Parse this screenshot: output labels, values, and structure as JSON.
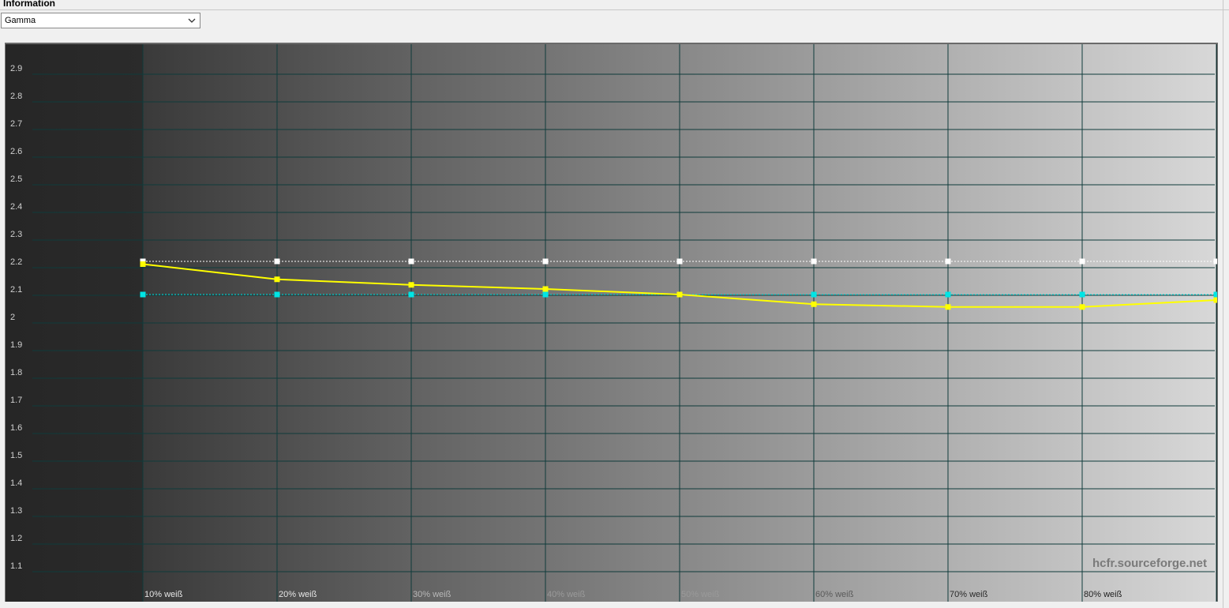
{
  "panel": {
    "title": "Information",
    "select_value": "Gamma"
  },
  "chart_data": {
    "type": "line",
    "title": "",
    "xlabel": "",
    "ylabel": "",
    "categories": [
      "",
      "10% weiß",
      "20% weiß",
      "30% weiß",
      "40% weiß",
      "50% weiß",
      "60% weiß",
      "70% weiß",
      "80% weiß",
      ""
    ],
    "y_ticks": [
      "2.9",
      "2.8",
      "2.7",
      "2.6",
      "2.5",
      "2.4",
      "2.3",
      "2.2",
      "2.1",
      "2",
      "1.9",
      "1.8",
      "1.7",
      "1.6",
      "1.5",
      "1.4",
      "1.3",
      "1.2",
      "1.1"
    ],
    "ylim": [
      1.0,
      2.95
    ],
    "grid": true,
    "series": [
      {
        "color": "#ffff00",
        "style": "solid",
        "x": [
          10,
          20,
          30,
          40,
          50,
          60,
          70,
          80,
          90
        ],
        "values": [
          2.19,
          2.135,
          2.115,
          2.1,
          2.08,
          2.045,
          2.035,
          2.035,
          2.06
        ]
      },
      {
        "color": "#ffffff",
        "style": "dotted",
        "x": [
          10,
          20,
          30,
          40,
          50,
          60,
          70,
          80,
          90
        ],
        "values": [
          2.2,
          2.2,
          2.2,
          2.2,
          2.2,
          2.2,
          2.2,
          2.2,
          2.2
        ]
      },
      {
        "color": "#00e5e5",
        "style": "dotted",
        "x": [
          10,
          20,
          30,
          40,
          50,
          60,
          70,
          80,
          90
        ],
        "values": [
          2.08,
          2.08,
          2.08,
          2.08,
          2.08,
          2.08,
          2.08,
          2.08,
          2.08
        ]
      }
    ],
    "watermark": "hcfr.sourceforge.net"
  }
}
